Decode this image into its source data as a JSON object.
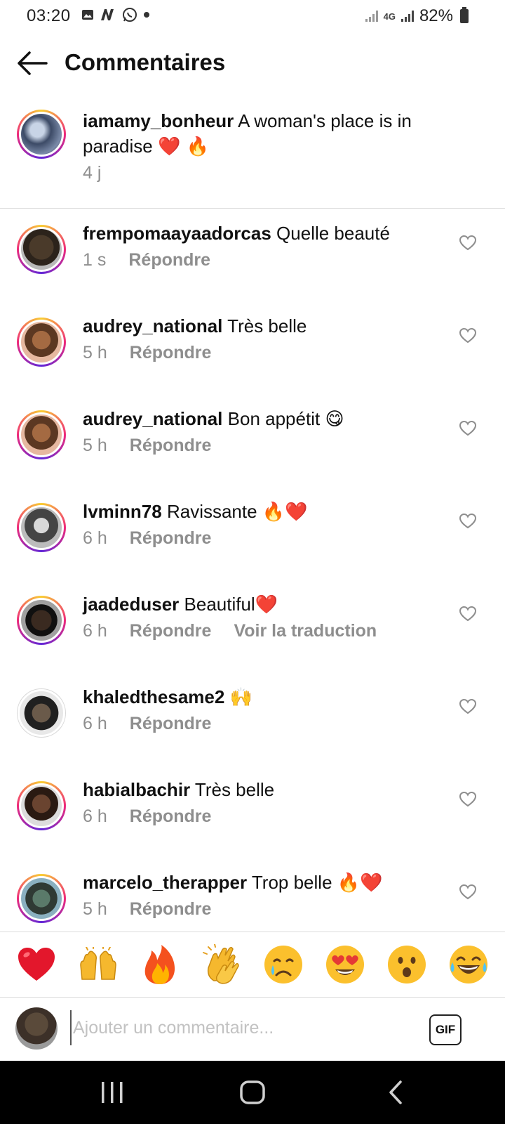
{
  "status_bar": {
    "time": "03:20",
    "signal_4g": "4G",
    "battery": "82%"
  },
  "header": {
    "title": "Commentaires"
  },
  "caption": {
    "username": "iamamy_bonheur",
    "text": "A woman's place is in paradise",
    "emojis": "❤️ 🔥",
    "time": "4 j"
  },
  "comments": [
    {
      "username": "frempomaayaadorcas",
      "text": "Quelle beauté",
      "emojis": "",
      "time": "1 s",
      "reply": "Répondre"
    },
    {
      "username": "audrey_national",
      "text": "Très belle",
      "emojis": "",
      "time": "5 h",
      "reply": "Répondre"
    },
    {
      "username": "audrey_national",
      "text": "Bon appétit",
      "emojis": "😋",
      "time": "5 h",
      "reply": "Répondre"
    },
    {
      "username": "lvminn78",
      "text": "Ravissante",
      "emojis": "🔥❤️",
      "time": "6 h",
      "reply": "Répondre"
    },
    {
      "username": "jaadeduser",
      "text": "Beautiful",
      "emojis": "❤️",
      "time": "6 h",
      "reply": "Répondre",
      "translate": "Voir la traduction"
    },
    {
      "username": "khaledthesame2",
      "text": "",
      "emojis": "🙌",
      "time": "6 h",
      "reply": "Répondre"
    },
    {
      "username": "habialbachir",
      "text": "Très belle",
      "emojis": "",
      "time": "6 h",
      "reply": "Répondre"
    },
    {
      "username": "marcelo_therapper",
      "text": "Trop belle",
      "emojis": "🔥❤️",
      "time": "5 h",
      "reply": "Répondre"
    }
  ],
  "reactions": [
    "❤️",
    "🙌",
    "🔥",
    "👏",
    "😢",
    "😍",
    "😮",
    "😂"
  ],
  "input": {
    "placeholder": "Ajouter un commentaire...",
    "gif_label": "GIF"
  },
  "icons": {
    "back": "arrow-left-icon",
    "like": "heart-outline-icon",
    "nav_recents": "recents-icon",
    "nav_home": "home-icon",
    "nav_back": "nav-back-icon"
  }
}
